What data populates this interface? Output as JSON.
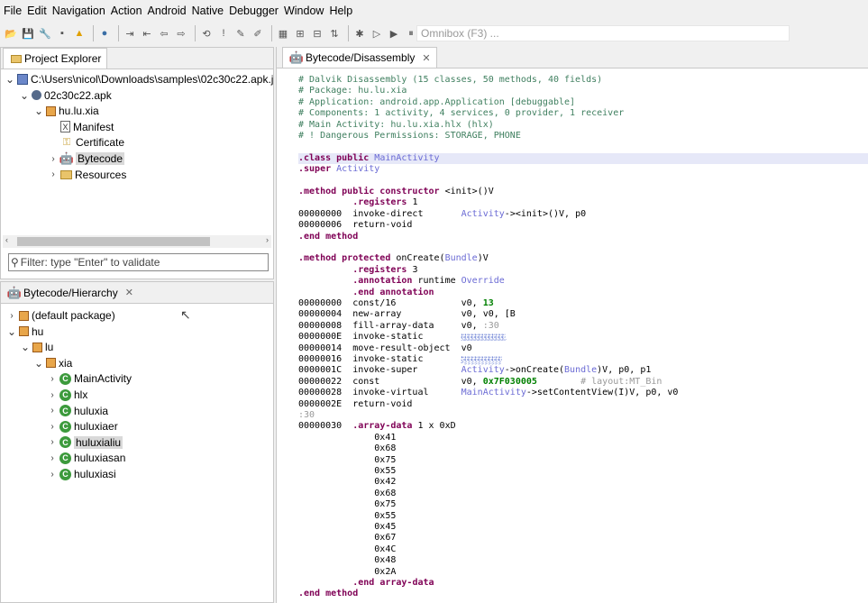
{
  "menu": [
    "File",
    "Edit",
    "Navigation",
    "Action",
    "Android",
    "Native",
    "Debugger",
    "Window",
    "Help"
  ],
  "omnibox_placeholder": "Omnibox (F3) ...",
  "project_explorer": {
    "tab_label": "Project Explorer",
    "tree": [
      {
        "label": "C:\\Users\\nicol\\Downloads\\samples\\02c30c22.apk.j",
        "icon": "jar-icon",
        "depth": 0,
        "twisty": "open"
      },
      {
        "label": "02c30c22.apk",
        "icon": "apk-icon",
        "depth": 1,
        "twisty": "open"
      },
      {
        "label": "hu.lu.xia",
        "icon": "package-icon",
        "depth": 2,
        "twisty": "open"
      },
      {
        "label": "Manifest",
        "icon": "xml-file-icon",
        "depth": 3,
        "twisty": "none"
      },
      {
        "label": "Certificate",
        "icon": "key-icon",
        "depth": 3,
        "twisty": "none"
      },
      {
        "label": "Bytecode",
        "icon": "android-icon",
        "depth": 3,
        "twisty": "closed",
        "selected": true
      },
      {
        "label": "Resources",
        "icon": "folder-icon",
        "depth": 3,
        "twisty": "closed"
      }
    ],
    "filter_placeholder": "Filter: type \"Enter\" to validate"
  },
  "hierarchy": {
    "tab_label": "Bytecode/Hierarchy",
    "tree": [
      {
        "label": "(default package)",
        "icon": "package-icon",
        "depth": 0,
        "twisty": "closed"
      },
      {
        "label": "hu",
        "icon": "package-icon",
        "depth": 0,
        "twisty": "open"
      },
      {
        "label": "lu",
        "icon": "package-icon",
        "depth": 1,
        "twisty": "open"
      },
      {
        "label": "xia",
        "icon": "package-icon",
        "depth": 2,
        "twisty": "open"
      },
      {
        "label": "MainActivity",
        "icon": "class-icon",
        "depth": 3,
        "twisty": "closed"
      },
      {
        "label": "hlx",
        "icon": "class-icon",
        "depth": 3,
        "twisty": "closed"
      },
      {
        "label": "huluxia",
        "icon": "class-icon",
        "depth": 3,
        "twisty": "closed"
      },
      {
        "label": "huluxiaer",
        "icon": "class-icon",
        "depth": 3,
        "twisty": "closed"
      },
      {
        "label": "huluxialiu",
        "icon": "class-icon",
        "depth": 3,
        "twisty": "closed",
        "selected": true
      },
      {
        "label": "huluxiasan",
        "icon": "class-icon",
        "depth": 3,
        "twisty": "closed"
      },
      {
        "label": "huluxiasi",
        "icon": "class-icon",
        "depth": 3,
        "twisty": "closed"
      }
    ]
  },
  "editor": {
    "tab_label": "Bytecode/Disassembly",
    "lines": [
      {
        "parts": [
          [
            "cm",
            "# Dalvik Disassembly (15 classes, 50 methods, 40 fields)"
          ]
        ]
      },
      {
        "parts": [
          [
            "cm",
            "# Package: hu.lu.xia"
          ]
        ]
      },
      {
        "parts": [
          [
            "cm",
            "# Application: android.app.Application [debuggable]"
          ]
        ]
      },
      {
        "parts": [
          [
            "cm",
            "# Components: 1 activity, 4 services, 0 provider, 1 receiver"
          ]
        ]
      },
      {
        "parts": [
          [
            "cm",
            "# Main Activity: hu.lu.xia.hlx (hlx)"
          ]
        ]
      },
      {
        "parts": [
          [
            "cm",
            "# ! Dangerous Permissions: STORAGE, PHONE"
          ]
        ]
      },
      {
        "parts": []
      },
      {
        "hl": true,
        "parts": [
          [
            "kw",
            ".class public "
          ],
          [
            "ty",
            "MainActivity"
          ]
        ]
      },
      {
        "parts": [
          [
            "kw",
            ".super "
          ],
          [
            "ty",
            "Activity"
          ]
        ]
      },
      {
        "parts": []
      },
      {
        "parts": [
          [
            "kw",
            ".method public constructor "
          ],
          [
            "",
            "<init>()V"
          ]
        ]
      },
      {
        "parts": [
          [
            "",
            "          "
          ],
          [
            "kw",
            ".registers "
          ],
          [
            "",
            "1"
          ]
        ]
      },
      {
        "parts": [
          [
            "",
            "00000000  invoke-direct       "
          ],
          [
            "ty",
            "Activity"
          ],
          [
            "",
            "-><init>()V, p0"
          ]
        ]
      },
      {
        "parts": [
          [
            "",
            "00000006  return-void"
          ]
        ]
      },
      {
        "parts": [
          [
            "kw",
            ".end method"
          ]
        ]
      },
      {
        "parts": []
      },
      {
        "parts": [
          [
            "kw",
            ".method protected "
          ],
          [
            "",
            "onCreate("
          ],
          [
            "ty",
            "Bundle"
          ],
          [
            "",
            ")V"
          ]
        ]
      },
      {
        "parts": [
          [
            "",
            "          "
          ],
          [
            "kw",
            ".registers "
          ],
          [
            "",
            "3"
          ]
        ]
      },
      {
        "parts": [
          [
            "",
            "          "
          ],
          [
            "kw",
            ".annotation "
          ],
          [
            "",
            "runtime "
          ],
          [
            "ty",
            "Override"
          ]
        ]
      },
      {
        "parts": [
          [
            "",
            "          "
          ],
          [
            "kw",
            ".end annotation"
          ]
        ]
      },
      {
        "parts": [
          [
            "",
            "00000000  const/16            v0, "
          ],
          [
            "num",
            "13"
          ]
        ]
      },
      {
        "parts": [
          [
            "",
            "00000004  new-array           v0, v0, [B"
          ]
        ]
      },
      {
        "parts": [
          [
            "",
            "00000008  fill-array-data     v0, "
          ],
          [
            "note",
            ":30"
          ]
        ]
      },
      {
        "parts": [
          [
            "",
            "0000000E  invoke-static       "
          ],
          [
            "uni",
            "ۥۣ۟ۦۣۢۤۡۧۨۤۥۣ۟ۦۣۢۤۡۧۨۤۥۣ۟ۦۣۢۤۡۧۨۤۥۣ۟ۦۣۢۤۡۧۨۤۥۣ۟ۦۣۢۤۡۧۨۤۥۣ۟ۦۣۢۤۡۧۨۤۥۣ۟ۦۣۢۤۡۧۨۤۥۣ۟ۦۣۢۤۡۧۨۤۥۣ۟ۦۣۢۤۡۧۨۤۥۣ۟ۦۣۢۤۡۧۨۤۥۣ۟ۦۣۢۤۡۧۨۤۥۣ۟ۦۣۢۤۡۧۨۤۥۣ۟ۦۣۢۤۡۧۨۤ"
          ]
        ]
      },
      {
        "parts": [
          [
            "",
            "00000014  move-result-object  v0"
          ]
        ]
      },
      {
        "parts": [
          [
            "",
            "00000016  invoke-static       "
          ],
          [
            "uni",
            "ۣۢۤۡۥ۟ۦۣۣۧۨۤۢۤۡۥ۟ۦۣۣۧۨۤۢۤۡۥ۟ۦۣۣۧۨۤۢۤۡۥ۟ۦۣۣۧۨۤۢۤۡۥ۟ۦۣۣۧۨۤۢۤۡۥ۟ۦۣۣۧۨۤۢۤۡۥ۟ۦۣۣۧۨۤۢۤۡۥ۟ۦۣۣۧۨۤۢۤۡۥ۟ۦۣۣۧۨۤۢۤۡۥ۟ۦۣۣۧۨۤۢۤۡۥ۟ۦۣۣۧۨۤۢۤۡۥ۟ۦۣۧۨۤ"
          ]
        ]
      },
      {
        "parts": [
          [
            "",
            "0000001C  invoke-super        "
          ],
          [
            "ty",
            "Activity"
          ],
          [
            "",
            "->onCreate("
          ],
          [
            "ty",
            "Bundle"
          ],
          [
            "",
            ")V, p0, p1"
          ]
        ]
      },
      {
        "parts": [
          [
            "",
            "00000022  const               v0, "
          ],
          [
            "num",
            "0x7F030005"
          ],
          [
            "",
            "        "
          ],
          [
            "note",
            "# layout:MT_Bin"
          ]
        ]
      },
      {
        "parts": [
          [
            "",
            "00000028  invoke-virtual      "
          ],
          [
            "ty",
            "MainActivity"
          ],
          [
            "",
            "->setContentView(I)V, p0, v0"
          ]
        ]
      },
      {
        "parts": [
          [
            "",
            "0000002E  return-void"
          ]
        ]
      },
      {
        "parts": [
          [
            "note",
            ":30"
          ]
        ]
      },
      {
        "parts": [
          [
            "",
            "00000030  "
          ],
          [
            "kw",
            ".array-data "
          ],
          [
            "",
            "1 x 0xD"
          ]
        ]
      },
      {
        "parts": [
          [
            "",
            "              0x41"
          ]
        ]
      },
      {
        "parts": [
          [
            "",
            "              0x68"
          ]
        ]
      },
      {
        "parts": [
          [
            "",
            "              0x75"
          ]
        ]
      },
      {
        "parts": [
          [
            "",
            "              0x55"
          ]
        ]
      },
      {
        "parts": [
          [
            "",
            "              0x42"
          ]
        ]
      },
      {
        "parts": [
          [
            "",
            "              0x68"
          ]
        ]
      },
      {
        "parts": [
          [
            "",
            "              0x75"
          ]
        ]
      },
      {
        "parts": [
          [
            "",
            "              0x55"
          ]
        ]
      },
      {
        "parts": [
          [
            "",
            "              0x45"
          ]
        ]
      },
      {
        "parts": [
          [
            "",
            "              0x67"
          ]
        ]
      },
      {
        "parts": [
          [
            "",
            "              0x4C"
          ]
        ]
      },
      {
        "parts": [
          [
            "",
            "              0x48"
          ]
        ]
      },
      {
        "parts": [
          [
            "",
            "              0x2A"
          ]
        ]
      },
      {
        "parts": [
          [
            "",
            "          "
          ],
          [
            "kw",
            ".end array-data"
          ]
        ]
      },
      {
        "parts": [
          [
            "kw",
            ".end method"
          ]
        ]
      }
    ]
  }
}
